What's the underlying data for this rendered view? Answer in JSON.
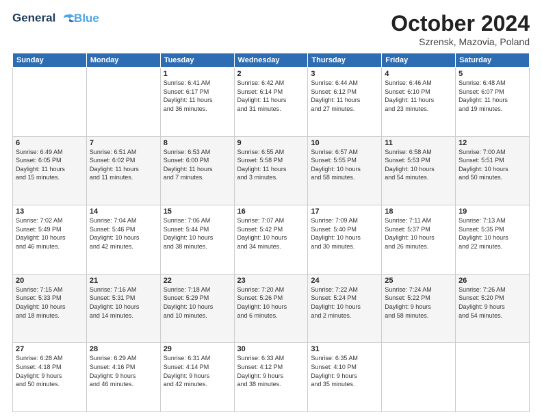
{
  "logo": {
    "line1": "General",
    "line2": "Blue"
  },
  "title": "October 2024",
  "location": "Szrensk, Mazovia, Poland",
  "days_of_week": [
    "Sunday",
    "Monday",
    "Tuesday",
    "Wednesday",
    "Thursday",
    "Friday",
    "Saturday"
  ],
  "weeks": [
    [
      {
        "day": "",
        "info": ""
      },
      {
        "day": "",
        "info": ""
      },
      {
        "day": "1",
        "info": "Sunrise: 6:41 AM\nSunset: 6:17 PM\nDaylight: 11 hours\nand 36 minutes."
      },
      {
        "day": "2",
        "info": "Sunrise: 6:42 AM\nSunset: 6:14 PM\nDaylight: 11 hours\nand 31 minutes."
      },
      {
        "day": "3",
        "info": "Sunrise: 6:44 AM\nSunset: 6:12 PM\nDaylight: 11 hours\nand 27 minutes."
      },
      {
        "day": "4",
        "info": "Sunrise: 6:46 AM\nSunset: 6:10 PM\nDaylight: 11 hours\nand 23 minutes."
      },
      {
        "day": "5",
        "info": "Sunrise: 6:48 AM\nSunset: 6:07 PM\nDaylight: 11 hours\nand 19 minutes."
      }
    ],
    [
      {
        "day": "6",
        "info": "Sunrise: 6:49 AM\nSunset: 6:05 PM\nDaylight: 11 hours\nand 15 minutes."
      },
      {
        "day": "7",
        "info": "Sunrise: 6:51 AM\nSunset: 6:02 PM\nDaylight: 11 hours\nand 11 minutes."
      },
      {
        "day": "8",
        "info": "Sunrise: 6:53 AM\nSunset: 6:00 PM\nDaylight: 11 hours\nand 7 minutes."
      },
      {
        "day": "9",
        "info": "Sunrise: 6:55 AM\nSunset: 5:58 PM\nDaylight: 11 hours\nand 3 minutes."
      },
      {
        "day": "10",
        "info": "Sunrise: 6:57 AM\nSunset: 5:55 PM\nDaylight: 10 hours\nand 58 minutes."
      },
      {
        "day": "11",
        "info": "Sunrise: 6:58 AM\nSunset: 5:53 PM\nDaylight: 10 hours\nand 54 minutes."
      },
      {
        "day": "12",
        "info": "Sunrise: 7:00 AM\nSunset: 5:51 PM\nDaylight: 10 hours\nand 50 minutes."
      }
    ],
    [
      {
        "day": "13",
        "info": "Sunrise: 7:02 AM\nSunset: 5:49 PM\nDaylight: 10 hours\nand 46 minutes."
      },
      {
        "day": "14",
        "info": "Sunrise: 7:04 AM\nSunset: 5:46 PM\nDaylight: 10 hours\nand 42 minutes."
      },
      {
        "day": "15",
        "info": "Sunrise: 7:06 AM\nSunset: 5:44 PM\nDaylight: 10 hours\nand 38 minutes."
      },
      {
        "day": "16",
        "info": "Sunrise: 7:07 AM\nSunset: 5:42 PM\nDaylight: 10 hours\nand 34 minutes."
      },
      {
        "day": "17",
        "info": "Sunrise: 7:09 AM\nSunset: 5:40 PM\nDaylight: 10 hours\nand 30 minutes."
      },
      {
        "day": "18",
        "info": "Sunrise: 7:11 AM\nSunset: 5:37 PM\nDaylight: 10 hours\nand 26 minutes."
      },
      {
        "day": "19",
        "info": "Sunrise: 7:13 AM\nSunset: 5:35 PM\nDaylight: 10 hours\nand 22 minutes."
      }
    ],
    [
      {
        "day": "20",
        "info": "Sunrise: 7:15 AM\nSunset: 5:33 PM\nDaylight: 10 hours\nand 18 minutes."
      },
      {
        "day": "21",
        "info": "Sunrise: 7:16 AM\nSunset: 5:31 PM\nDaylight: 10 hours\nand 14 minutes."
      },
      {
        "day": "22",
        "info": "Sunrise: 7:18 AM\nSunset: 5:29 PM\nDaylight: 10 hours\nand 10 minutes."
      },
      {
        "day": "23",
        "info": "Sunrise: 7:20 AM\nSunset: 5:26 PM\nDaylight: 10 hours\nand 6 minutes."
      },
      {
        "day": "24",
        "info": "Sunrise: 7:22 AM\nSunset: 5:24 PM\nDaylight: 10 hours\nand 2 minutes."
      },
      {
        "day": "25",
        "info": "Sunrise: 7:24 AM\nSunset: 5:22 PM\nDaylight: 9 hours\nand 58 minutes."
      },
      {
        "day": "26",
        "info": "Sunrise: 7:26 AM\nSunset: 5:20 PM\nDaylight: 9 hours\nand 54 minutes."
      }
    ],
    [
      {
        "day": "27",
        "info": "Sunrise: 6:28 AM\nSunset: 4:18 PM\nDaylight: 9 hours\nand 50 minutes."
      },
      {
        "day": "28",
        "info": "Sunrise: 6:29 AM\nSunset: 4:16 PM\nDaylight: 9 hours\nand 46 minutes."
      },
      {
        "day": "29",
        "info": "Sunrise: 6:31 AM\nSunset: 4:14 PM\nDaylight: 9 hours\nand 42 minutes."
      },
      {
        "day": "30",
        "info": "Sunrise: 6:33 AM\nSunset: 4:12 PM\nDaylight: 9 hours\nand 38 minutes."
      },
      {
        "day": "31",
        "info": "Sunrise: 6:35 AM\nSunset: 4:10 PM\nDaylight: 9 hours\nand 35 minutes."
      },
      {
        "day": "",
        "info": ""
      },
      {
        "day": "",
        "info": ""
      }
    ]
  ]
}
